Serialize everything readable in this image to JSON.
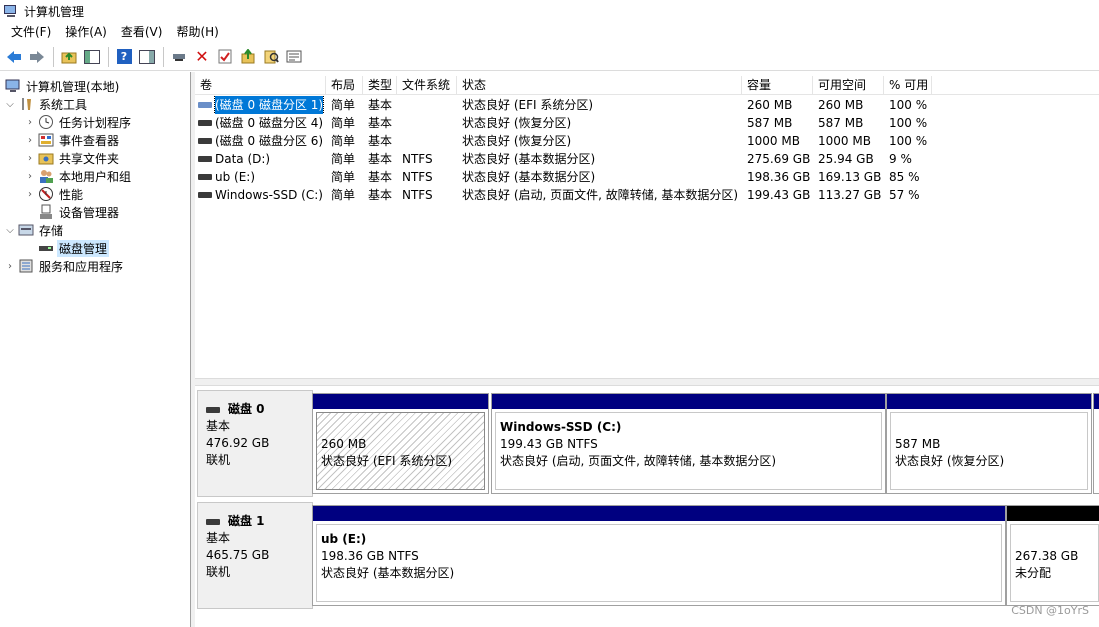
{
  "window": {
    "title": "计算机管理"
  },
  "menu": [
    {
      "label": "文件(F)"
    },
    {
      "label": "操作(A)"
    },
    {
      "label": "查看(V)"
    },
    {
      "label": "帮助(H)"
    }
  ],
  "toolbar": {
    "icons": [
      "back-icon",
      "forward-icon",
      "up-folder-icon",
      "show-hide-tree-icon",
      "help-icon",
      "action-pane-icon",
      "connect-icon",
      "delete-icon",
      "check-icon",
      "export-icon",
      "search-icon",
      "properties-icon"
    ]
  },
  "tree": {
    "root": "计算机管理(本地)",
    "system_tools": "系统工具",
    "task_scheduler": "任务计划程序",
    "event_viewer": "事件查看器",
    "shared_folders": "共享文件夹",
    "local_users": "本地用户和组",
    "performance": "性能",
    "device_manager": "设备管理器",
    "storage": "存储",
    "disk_management": "磁盘管理",
    "services_apps": "服务和应用程序"
  },
  "list": {
    "columns": [
      "卷",
      "布局",
      "类型",
      "文件系统",
      "状态",
      "容量",
      "可用空间",
      "% 可用"
    ],
    "rows": [
      {
        "vol": "(磁盘 0 磁盘分区 1)",
        "layout": "简单",
        "type": "基本",
        "fs": "",
        "status": "状态良好 (EFI 系统分区)",
        "capacity": "260 MB",
        "free": "260 MB",
        "pct": "100 %"
      },
      {
        "vol": "(磁盘 0 磁盘分区 4)",
        "layout": "简单",
        "type": "基本",
        "fs": "",
        "status": "状态良好 (恢复分区)",
        "capacity": "587 MB",
        "free": "587 MB",
        "pct": "100 %"
      },
      {
        "vol": "(磁盘 0 磁盘分区 6)",
        "layout": "简单",
        "type": "基本",
        "fs": "",
        "status": "状态良好 (恢复分区)",
        "capacity": "1000 MB",
        "free": "1000 MB",
        "pct": "100 %"
      },
      {
        "vol": "Data (D:)",
        "layout": "简单",
        "type": "基本",
        "fs": "NTFS",
        "status": "状态良好 (基本数据分区)",
        "capacity": "275.69 GB",
        "free": "25.94 GB",
        "pct": "9 %"
      },
      {
        "vol": "ub (E:)",
        "layout": "简单",
        "type": "基本",
        "fs": "NTFS",
        "status": "状态良好 (基本数据分区)",
        "capacity": "198.36 GB",
        "free": "169.13 GB",
        "pct": "85 %"
      },
      {
        "vol": "Windows-SSD (C:)",
        "layout": "简单",
        "type": "基本",
        "fs": "NTFS",
        "status": "状态良好 (启动, 页面文件, 故障转储, 基本数据分区)",
        "capacity": "199.43 GB",
        "free": "113.27 GB",
        "pct": "57 %"
      }
    ]
  },
  "disks": [
    {
      "name": "磁盘 0",
      "type": "基本",
      "size": "476.92 GB",
      "state": "联机",
      "partitions": [
        {
          "name": "",
          "size": "260 MB",
          "status": "状态良好 (EFI 系统分区)"
        },
        {
          "name": "Windows-SSD  (C:)",
          "size": "199.43 GB NTFS",
          "status": "状态良好 (启动, 页面文件, 故障转储, 基本数据分区)"
        },
        {
          "name": "",
          "size": "587 MB",
          "status": "状态良好 (恢复分区)"
        }
      ]
    },
    {
      "name": "磁盘 1",
      "type": "基本",
      "size": "465.75 GB",
      "state": "联机",
      "partitions": [
        {
          "name": "ub  (E:)",
          "size": "198.36 GB NTFS",
          "status": "状态良好 (基本数据分区)"
        },
        {
          "name": "",
          "size": "267.38 GB",
          "status": "未分配"
        }
      ]
    }
  ],
  "watermark": "CSDN @1oYrS"
}
